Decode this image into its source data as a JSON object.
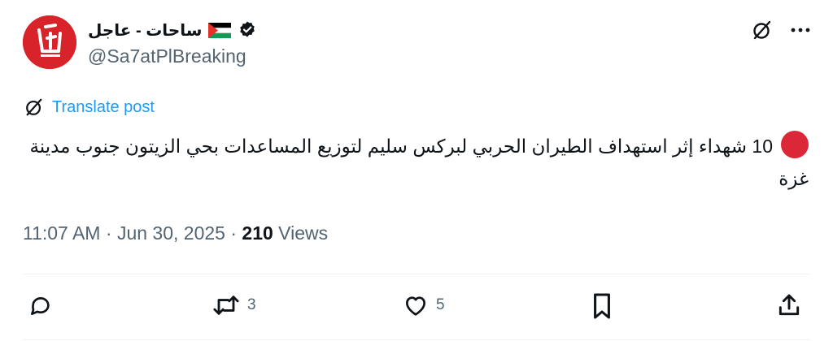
{
  "author": {
    "display_name": "ساحات - عاجل",
    "handle": "@Sa7atPlBreaking",
    "avatar_icon": "sahat-logo-icon",
    "flag_icon": "palestine-flag-icon",
    "verified_icon": "verified-badge-icon"
  },
  "header_actions": {
    "grok_icon": "grok-icon",
    "more_icon": "more-icon"
  },
  "translate": {
    "label": "Translate post",
    "icon": "grok-icon"
  },
  "tweet": {
    "text": "10 شهداء إثر استهداف الطيران الحربي لبركس سليم لتوزيع المساعدات بحي الزيتون جنوب مدينة غزة",
    "leading_emoji": "red-circle-icon"
  },
  "meta": {
    "time": "11:07 AM",
    "separator": "·",
    "date": "Jun 30, 2025",
    "views_count": "210",
    "views_label": "Views"
  },
  "actions": {
    "reply_count": "",
    "repost_count": "3",
    "like_count": "5"
  },
  "colors": {
    "accent": "#1d9bf0",
    "secondary_text": "#536471",
    "avatar_red": "#d8232a",
    "red_circle": "#dc2738"
  }
}
